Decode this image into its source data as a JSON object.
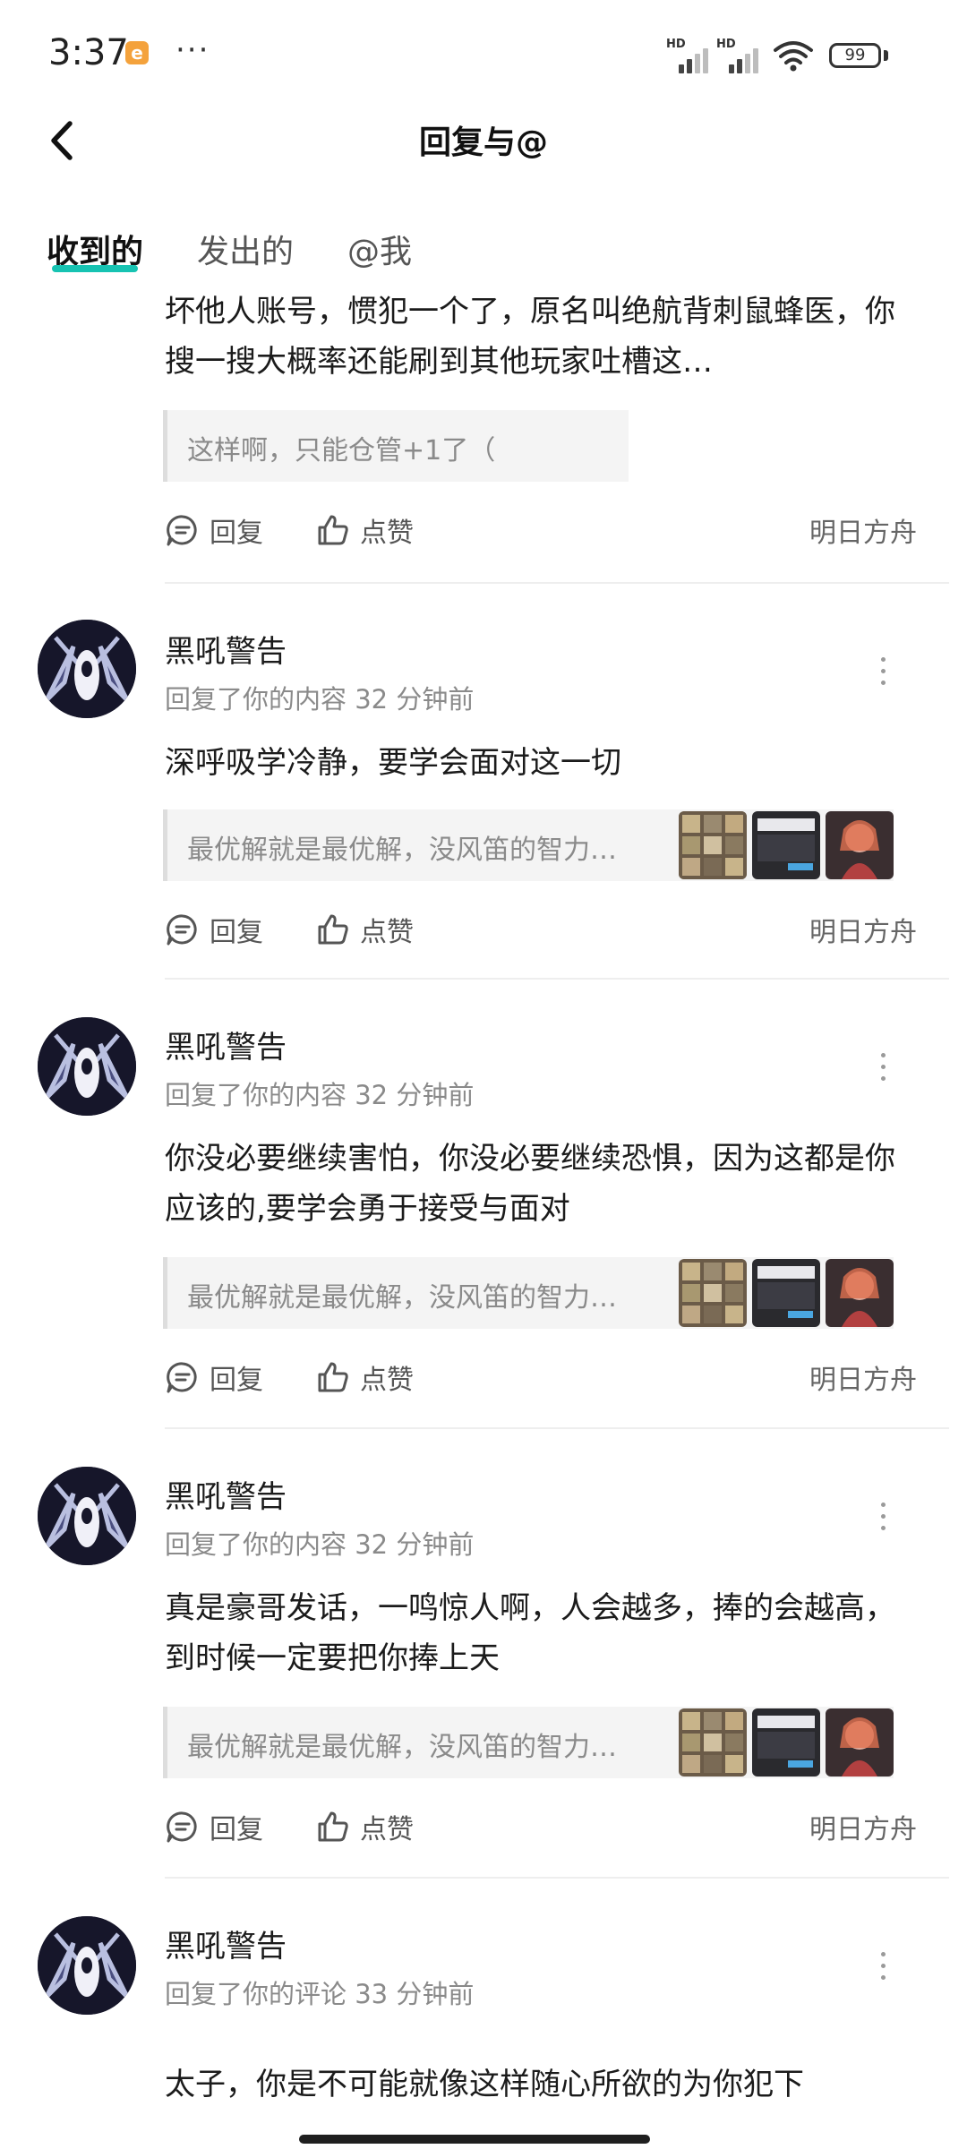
{
  "status_bar": {
    "time": "3:37",
    "app_badge": "e",
    "overflow": "···",
    "signal_1": "HD",
    "signal_2": "HD",
    "battery": "99"
  },
  "header": {
    "title": "回复与@"
  },
  "tabs": [
    {
      "label": "收到的",
      "active": true
    },
    {
      "label": "发出的",
      "active": false
    },
    {
      "label": "@我",
      "active": false
    }
  ],
  "accent_color": "#17c3b2",
  "actions": {
    "reply": "回复",
    "like": "点赞"
  },
  "items": [
    {
      "content": "坏他人账号，惯犯一个了，原名叫绝航背刺鼠蜂医，你搜一搜大概率还能刷到其他玩家吐槽这…",
      "quote": "这样啊，只能仓管+1了（",
      "tag": "明日方舟"
    },
    {
      "user": "黑吼警告",
      "meta": "回复了你的内容 32 分钟前",
      "content": "深呼吸学冷静，要学会面对这一切",
      "quote": "最优解就是最优解，没风笛的智力…",
      "tag": "明日方舟"
    },
    {
      "user": "黑吼警告",
      "meta": "回复了你的内容 32 分钟前",
      "content": "你没必要继续害怕，你没必要继续恐惧，因为这都是你应该的,要学会勇于接受与面对",
      "quote": "最优解就是最优解，没风笛的智力…",
      "tag": "明日方舟"
    },
    {
      "user": "黑吼警告",
      "meta": "回复了你的内容 32 分钟前",
      "content": "真是豪哥发话，一鸣惊人啊，人会越多，捧的会越高，到时候一定要把你捧上天",
      "quote": "最优解就是最优解，没风笛的智力…",
      "tag": "明日方舟"
    },
    {
      "user": "黑吼警告",
      "meta": "回复了你的评论 33 分钟前",
      "content": "太子，你是不可能就像这样随心所欲的为你犯下"
    }
  ]
}
